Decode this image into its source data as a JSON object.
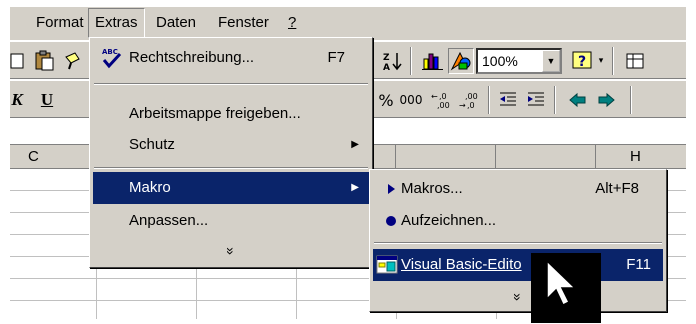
{
  "menubar": {
    "items": [
      {
        "label": "Format"
      },
      {
        "label": "Extras"
      },
      {
        "label": "Daten"
      },
      {
        "label": "Fenster"
      },
      {
        "label": "?"
      }
    ]
  },
  "toolbar": {
    "zoom_value": "100%",
    "number_format_percent": "%",
    "number_format_thousands": "000"
  },
  "grid": {
    "column_headers": [
      "C",
      "H"
    ]
  },
  "extras_menu": {
    "items": [
      {
        "label": "Rechtschreibung...",
        "shortcut": "F7",
        "icon": "spellcheck-icon"
      },
      {
        "label": "Arbeitsmappe freigeben..."
      },
      {
        "label": "Schutz",
        "submenu": true
      },
      {
        "label": "Makro",
        "submenu": true,
        "highlighted": true
      },
      {
        "label": "Anpassen..."
      }
    ],
    "more_glyph": "»"
  },
  "macro_menu": {
    "items": [
      {
        "label": "Makros...",
        "shortcut": "Alt+F8",
        "icon": "play-icon"
      },
      {
        "label": "Aufzeichnen...",
        "icon": "record-icon"
      },
      {
        "label": "Visual Basic-Edito",
        "shortcut": "F11",
        "icon": "vb-editor-icon",
        "highlighted": true
      }
    ],
    "more_glyph": "»"
  },
  "colors": {
    "face": "#d4d0c8",
    "highlight": "#0a246a",
    "highlight_text": "#ffffff"
  }
}
